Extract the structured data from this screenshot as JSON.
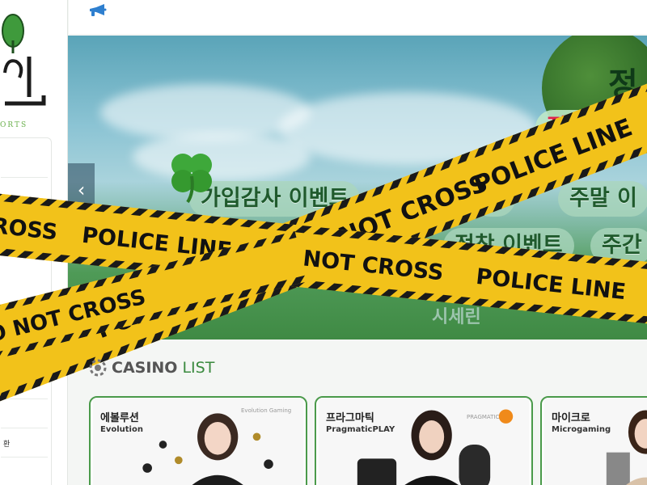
{
  "colors": {
    "accent_green": "#3a8a3e",
    "card_border": "#4a9a4a",
    "tape_yellow": "#f2c21a",
    "tape_black": "#1a1a1a",
    "pill_text": "#1f5a2c",
    "pill_bright_text": "#e0224a"
  },
  "logo": {
    "wordmark": "위",
    "tagline": "ORTS"
  },
  "sidebar": {
    "menu_fragment": "환"
  },
  "topbar": {
    "icon": "megaphone-icon"
  },
  "banner": {
    "title_fragment": "정",
    "pills": {
      "signup_event": "가입감사 이벤트",
      "second_event": "트",
      "weekend_event": "주말 이",
      "row2_first_event": "벤트",
      "settle_event": "정착 이벤트",
      "weekly_fragment": "주간",
      "top_bright_fragment": "정인",
      "faded_fragment": "시세린"
    },
    "prev_label": "‹",
    "clover_icon": "four-leaf-clover-icon"
  },
  "police_tape": {
    "phrase_a": "POLICE LINE",
    "phrase_b": "DO NOT CROSS"
  },
  "casino_section": {
    "title_strong": "CASINO",
    "title_light": "LIST",
    "icon": "casino-chip-icon",
    "cards": [
      {
        "name": "에볼루션",
        "subtitle": "Evolution",
        "brand_mark": "Evolution Gaming"
      },
      {
        "name": "프라그마틱",
        "subtitle": "PragmaticPLAY",
        "brand_mark": "PRAGMATIC"
      },
      {
        "name": "마이크로",
        "subtitle": "Microgaming",
        "brand_mark": ""
      }
    ]
  }
}
